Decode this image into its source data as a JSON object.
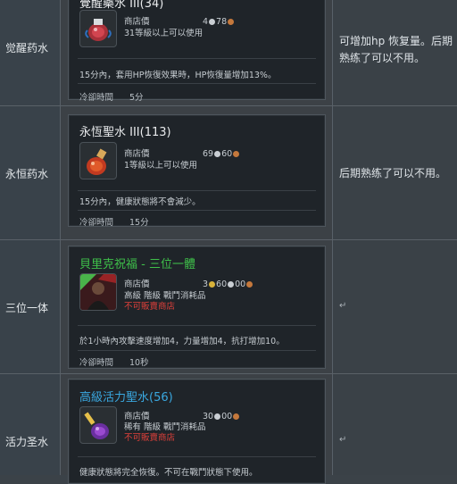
{
  "rows": [
    {
      "name": "觉醒药水",
      "note": "可增加hp 恢复量。后期熟练了可以不用。",
      "tooltip": {
        "title": "覺醒藥水 III(34)",
        "title_color": "#e8eaec",
        "shop_label": "商店價",
        "price": [
          "4",
          "78"
        ],
        "requirement": "31等級以上可以使用",
        "desc": "15分內，套用HP恢復效果時，HP恢復量增加13%。",
        "cooldown_label": "冷卻時間",
        "cooldown": "5分"
      }
    },
    {
      "name": "永恒药水",
      "note": "后期熟练了可以不用。",
      "tooltip": {
        "title": "永恆聖水 III(113)",
        "title_color": "#e8eaec",
        "shop_label": "商店價",
        "price": [
          "69",
          "60"
        ],
        "requirement": "1等級以上可以使用",
        "desc": "15分內，健康狀態將不會減少。",
        "cooldown_label": "冷卻時間",
        "cooldown": "15分"
      }
    },
    {
      "name": "三位一体",
      "note": "",
      "tooltip": {
        "title": "貝里克祝福 - 三位一體",
        "title_color": "#3fc04a",
        "shop_label": "商店價",
        "price": [
          "3",
          "60",
          "00"
        ],
        "grade_line": "高級  階級  戰鬥消耗品",
        "no_shop": "不可販賣商店",
        "desc": "於1小時內攻擊速度增加4，力量增加4，抗打增加10。",
        "cooldown_label": "冷卻時間",
        "cooldown": "10秒"
      }
    },
    {
      "name": "活力圣水",
      "note": "",
      "tooltip": {
        "title": "高級活力聖水(56)",
        "title_color": "#3aa8e0",
        "shop_label": "商店價",
        "price": [
          "30",
          "00"
        ],
        "grade_line": "稀有  階級  戰鬥消耗品",
        "no_shop": "不可販賣商店",
        "desc": "健康狀態將完全恢復。不可在戰鬥狀態下使用。"
      }
    }
  ],
  "colors": {
    "accent_red": "#e0403a",
    "silver_coin": "#c9ced3",
    "copper_coin": "#c4783c"
  }
}
